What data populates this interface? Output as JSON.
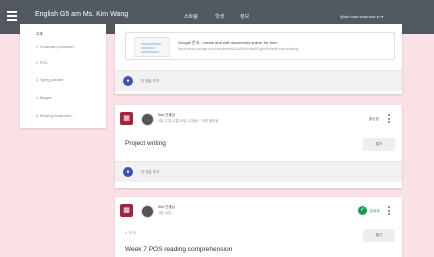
{
  "header": {
    "class_title": "English G5 am Ms. Kim Wang",
    "tabs": [
      {
        "label": "스트림",
        "active": true
      },
      {
        "label": "학생",
        "active": false
      },
      {
        "label": "정보",
        "active": false
      }
    ],
    "account": "@stu.tobe.sbps.edu.kr ▾"
  },
  "sidebar": {
    "items": [
      {
        "label": "주제"
      },
      {
        "label": "1. Vocabulary homework"
      },
      {
        "label": "2. POS"
      },
      {
        "label": "3. Typing practice"
      },
      {
        "label": "4. Badges"
      },
      {
        "label": "5. Reading comprehen..."
      }
    ]
  },
  "posts": [
    {
      "attachment": {
        "title": "Google 문서 - create and edit documents online, for free.",
        "url": "https://docs.google.com/document/d/1a2b3c4d5e6f7g8h9i0j/edit?usp=sharing"
      },
      "classmates_label": "반 댓글 추가"
    },
    {
      "author": "Kim 선생님",
      "meta": "2월 17일 (2월 20일 수정됨) · 과제 할당됨",
      "status": "할당됨",
      "title": "Project writing",
      "open_label": "열기",
      "classmates_label": "반 댓글 추가"
    },
    {
      "author": "Kim 선생님",
      "meta": "2월 14일",
      "status": "완료됨",
      "chip": "4. POS",
      "title": "Week 7 POS reading comprehension",
      "open_label": "열기"
    }
  ],
  "colors": {
    "header_bg": "#515a60",
    "page_bg": "#f9e1e5",
    "assignment_icon": "#a1253c",
    "done_green": "#0f9d58",
    "classmates_blue": "#3f51b5"
  }
}
